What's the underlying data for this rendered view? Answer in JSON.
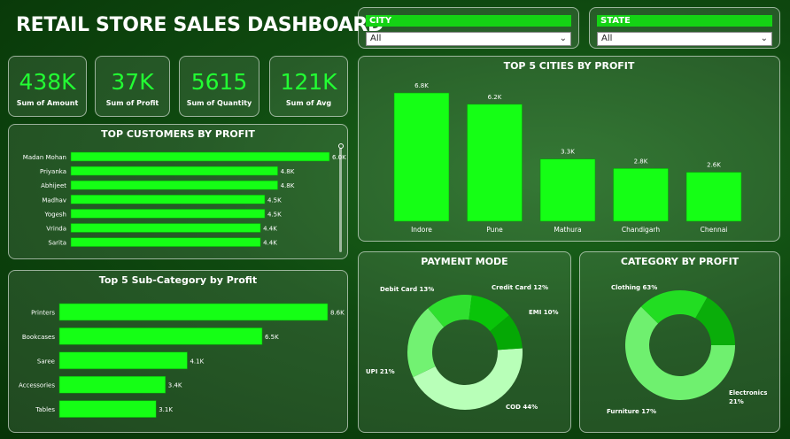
{
  "title": "RETAIL STORE SALES DASHBOARD",
  "slicers": {
    "city": {
      "label": "CITY",
      "value": "All"
    },
    "state": {
      "label": "STATE",
      "value": "All"
    }
  },
  "kpis": [
    {
      "value": "438K",
      "label": "Sum of Amount"
    },
    {
      "value": "37K",
      "label": "Sum of Profit"
    },
    {
      "value": "5615",
      "label": "Sum of Quantity"
    },
    {
      "value": "121K",
      "label": "Sum of Avg"
    }
  ],
  "colors": {
    "bar": "#15ff15",
    "bar_border": "#0b9b0b"
  },
  "chart_data": [
    {
      "id": "customers",
      "type": "bar",
      "orientation": "horizontal",
      "title": "TOP CUSTOMERS BY PROFIT",
      "categories": [
        "Madan Mohan",
        "Priyanka",
        "Abhijeet",
        "Madhav",
        "Yogesh",
        "Vrinda",
        "Sarita"
      ],
      "values": [
        6.0,
        4.8,
        4.8,
        4.5,
        4.5,
        4.4,
        4.4
      ],
      "labels": [
        "6.0K",
        "4.8K",
        "4.8K",
        "4.5K",
        "4.5K",
        "4.4K",
        "4.4K"
      ],
      "max": 6.0
    },
    {
      "id": "subcat",
      "type": "bar",
      "orientation": "horizontal",
      "title": "Top 5 Sub-Category by Profit",
      "categories": [
        "Printers",
        "Bookcases",
        "Saree",
        "Accessories",
        "Tables"
      ],
      "values": [
        8.6,
        6.5,
        4.1,
        3.4,
        3.1
      ],
      "labels": [
        "8.6K",
        "6.5K",
        "4.1K",
        "3.4K",
        "3.1K"
      ],
      "max": 8.6
    },
    {
      "id": "cities",
      "type": "bar",
      "orientation": "vertical",
      "title": "TOP 5 CITIES BY PROFIT",
      "categories": [
        "Indore",
        "Pune",
        "Mathura",
        "Chandigarh",
        "Chennai"
      ],
      "values": [
        6.8,
        6.2,
        3.3,
        2.8,
        2.6
      ],
      "labels": [
        "6.8K",
        "6.2K",
        "3.3K",
        "2.8K",
        "2.6K"
      ],
      "max": 6.8
    },
    {
      "id": "payment",
      "type": "pie",
      "title": "PAYMENT MODE",
      "slices": [
        {
          "name": "COD",
          "value": 44,
          "label": "COD 44%",
          "color": "#b8ffb8"
        },
        {
          "name": "UPI",
          "value": 21,
          "label": "UPI 21%",
          "color": "#72f272"
        },
        {
          "name": "Debit Card",
          "value": 13,
          "label": "Debit Card 13%",
          "color": "#2fe02f"
        },
        {
          "name": "Credit Card",
          "value": 12,
          "label": "Credit Card 12%",
          "color": "#09c409"
        },
        {
          "name": "EMI",
          "value": 10,
          "label": "EMI 10%",
          "color": "#05a805"
        }
      ]
    },
    {
      "id": "category",
      "type": "pie",
      "title": "CATEGORY BY PROFIT",
      "slices": [
        {
          "name": "Clothing",
          "value": 63,
          "label": "Clothing 63%",
          "color": "#6ff06f"
        },
        {
          "name": "Electronics",
          "value": 21,
          "label": "Electronics 21%",
          "color": "#22dd22"
        },
        {
          "name": "Furniture",
          "value": 17,
          "label": "Furniture 17%",
          "color": "#0aad0a"
        }
      ]
    }
  ]
}
